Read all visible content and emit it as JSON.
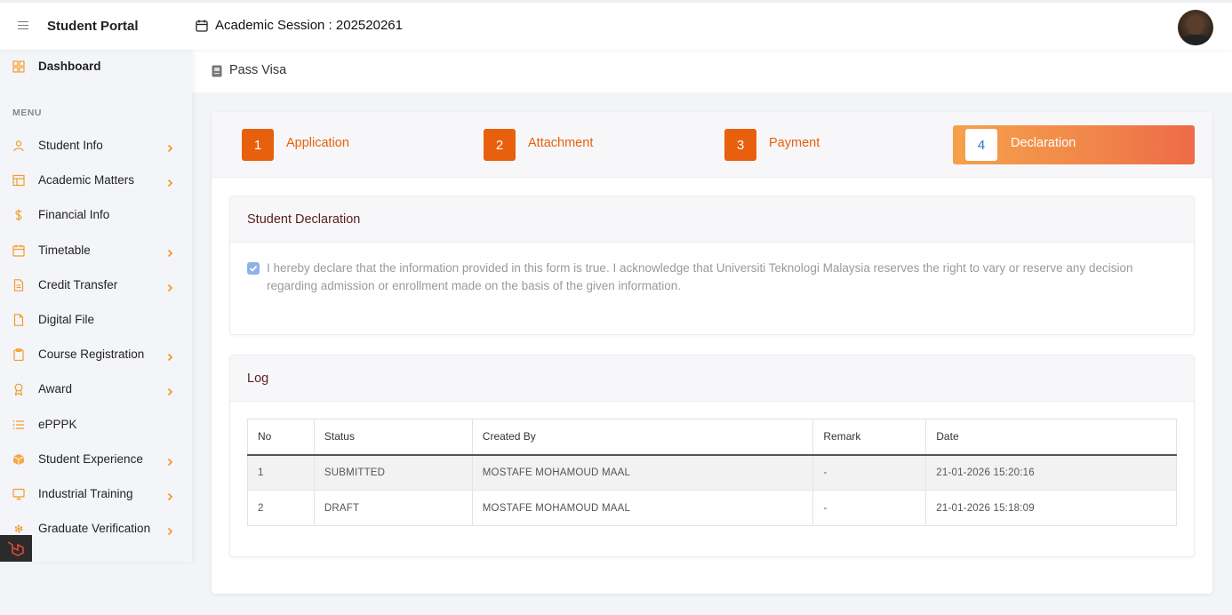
{
  "header": {
    "brand": "Student Portal",
    "session_label": "Academic Session : 202520261",
    "menu_icon": "hamburger-icon",
    "calendar_icon": "calendar-icon"
  },
  "sidebar": {
    "dashboard": "Dashboard",
    "menu_heading": "MENU",
    "items": [
      {
        "label": "Student Info",
        "icon": "user-icon",
        "has_children": true
      },
      {
        "label": "Academic Matters",
        "icon": "layout-icon",
        "has_children": true
      },
      {
        "label": "Financial Info",
        "icon": "dollar-icon",
        "has_children": false
      },
      {
        "label": "Timetable",
        "icon": "calendar-icon",
        "has_children": true
      },
      {
        "label": "Credit Transfer",
        "icon": "document-icon",
        "has_children": true
      },
      {
        "label": "Digital File",
        "icon": "file-icon",
        "has_children": false
      },
      {
        "label": "Course Registration",
        "icon": "clipboard-icon",
        "has_children": true
      },
      {
        "label": "Award",
        "icon": "award-icon",
        "has_children": true
      },
      {
        "label": "ePPPK",
        "icon": "list-icon",
        "has_children": false
      },
      {
        "label": "Student Experience",
        "icon": "box-icon",
        "has_children": true
      },
      {
        "label": "Industrial Training",
        "icon": "monitor-icon",
        "has_children": true
      },
      {
        "label": "Graduate Verification",
        "icon": "gear-icon",
        "has_children": true
      }
    ],
    "accent_color": "#f29b2c"
  },
  "page": {
    "title": "Pass Visa"
  },
  "wizard": {
    "steps": [
      {
        "number": "1",
        "label": "Application"
      },
      {
        "number": "2",
        "label": "Attachment"
      },
      {
        "number": "3",
        "label": "Payment"
      },
      {
        "number": "4",
        "label": "Declaration"
      }
    ],
    "active_step": 4,
    "accent_color": "#e8600d"
  },
  "declaration": {
    "title": "Student Declaration",
    "checked": true,
    "text": "I hereby declare that the information provided in this form is true. I acknowledge that Universiti Teknologi Malaysia reserves the right to vary or reserve any decision regarding admission or enrollment made on the basis of the given information."
  },
  "log": {
    "title": "Log",
    "columns": [
      "No",
      "Status",
      "Created By",
      "Remark",
      "Date"
    ],
    "rows": [
      [
        "1",
        "SUBMITTED",
        "MOSTAFE MOHAMOUD MAAL",
        "-",
        "21-01-2026 15:20:16"
      ],
      [
        "2",
        "DRAFT",
        "MOSTAFE MOHAMOUD MAAL",
        "-",
        "21-01-2026 15:18:09"
      ]
    ]
  }
}
